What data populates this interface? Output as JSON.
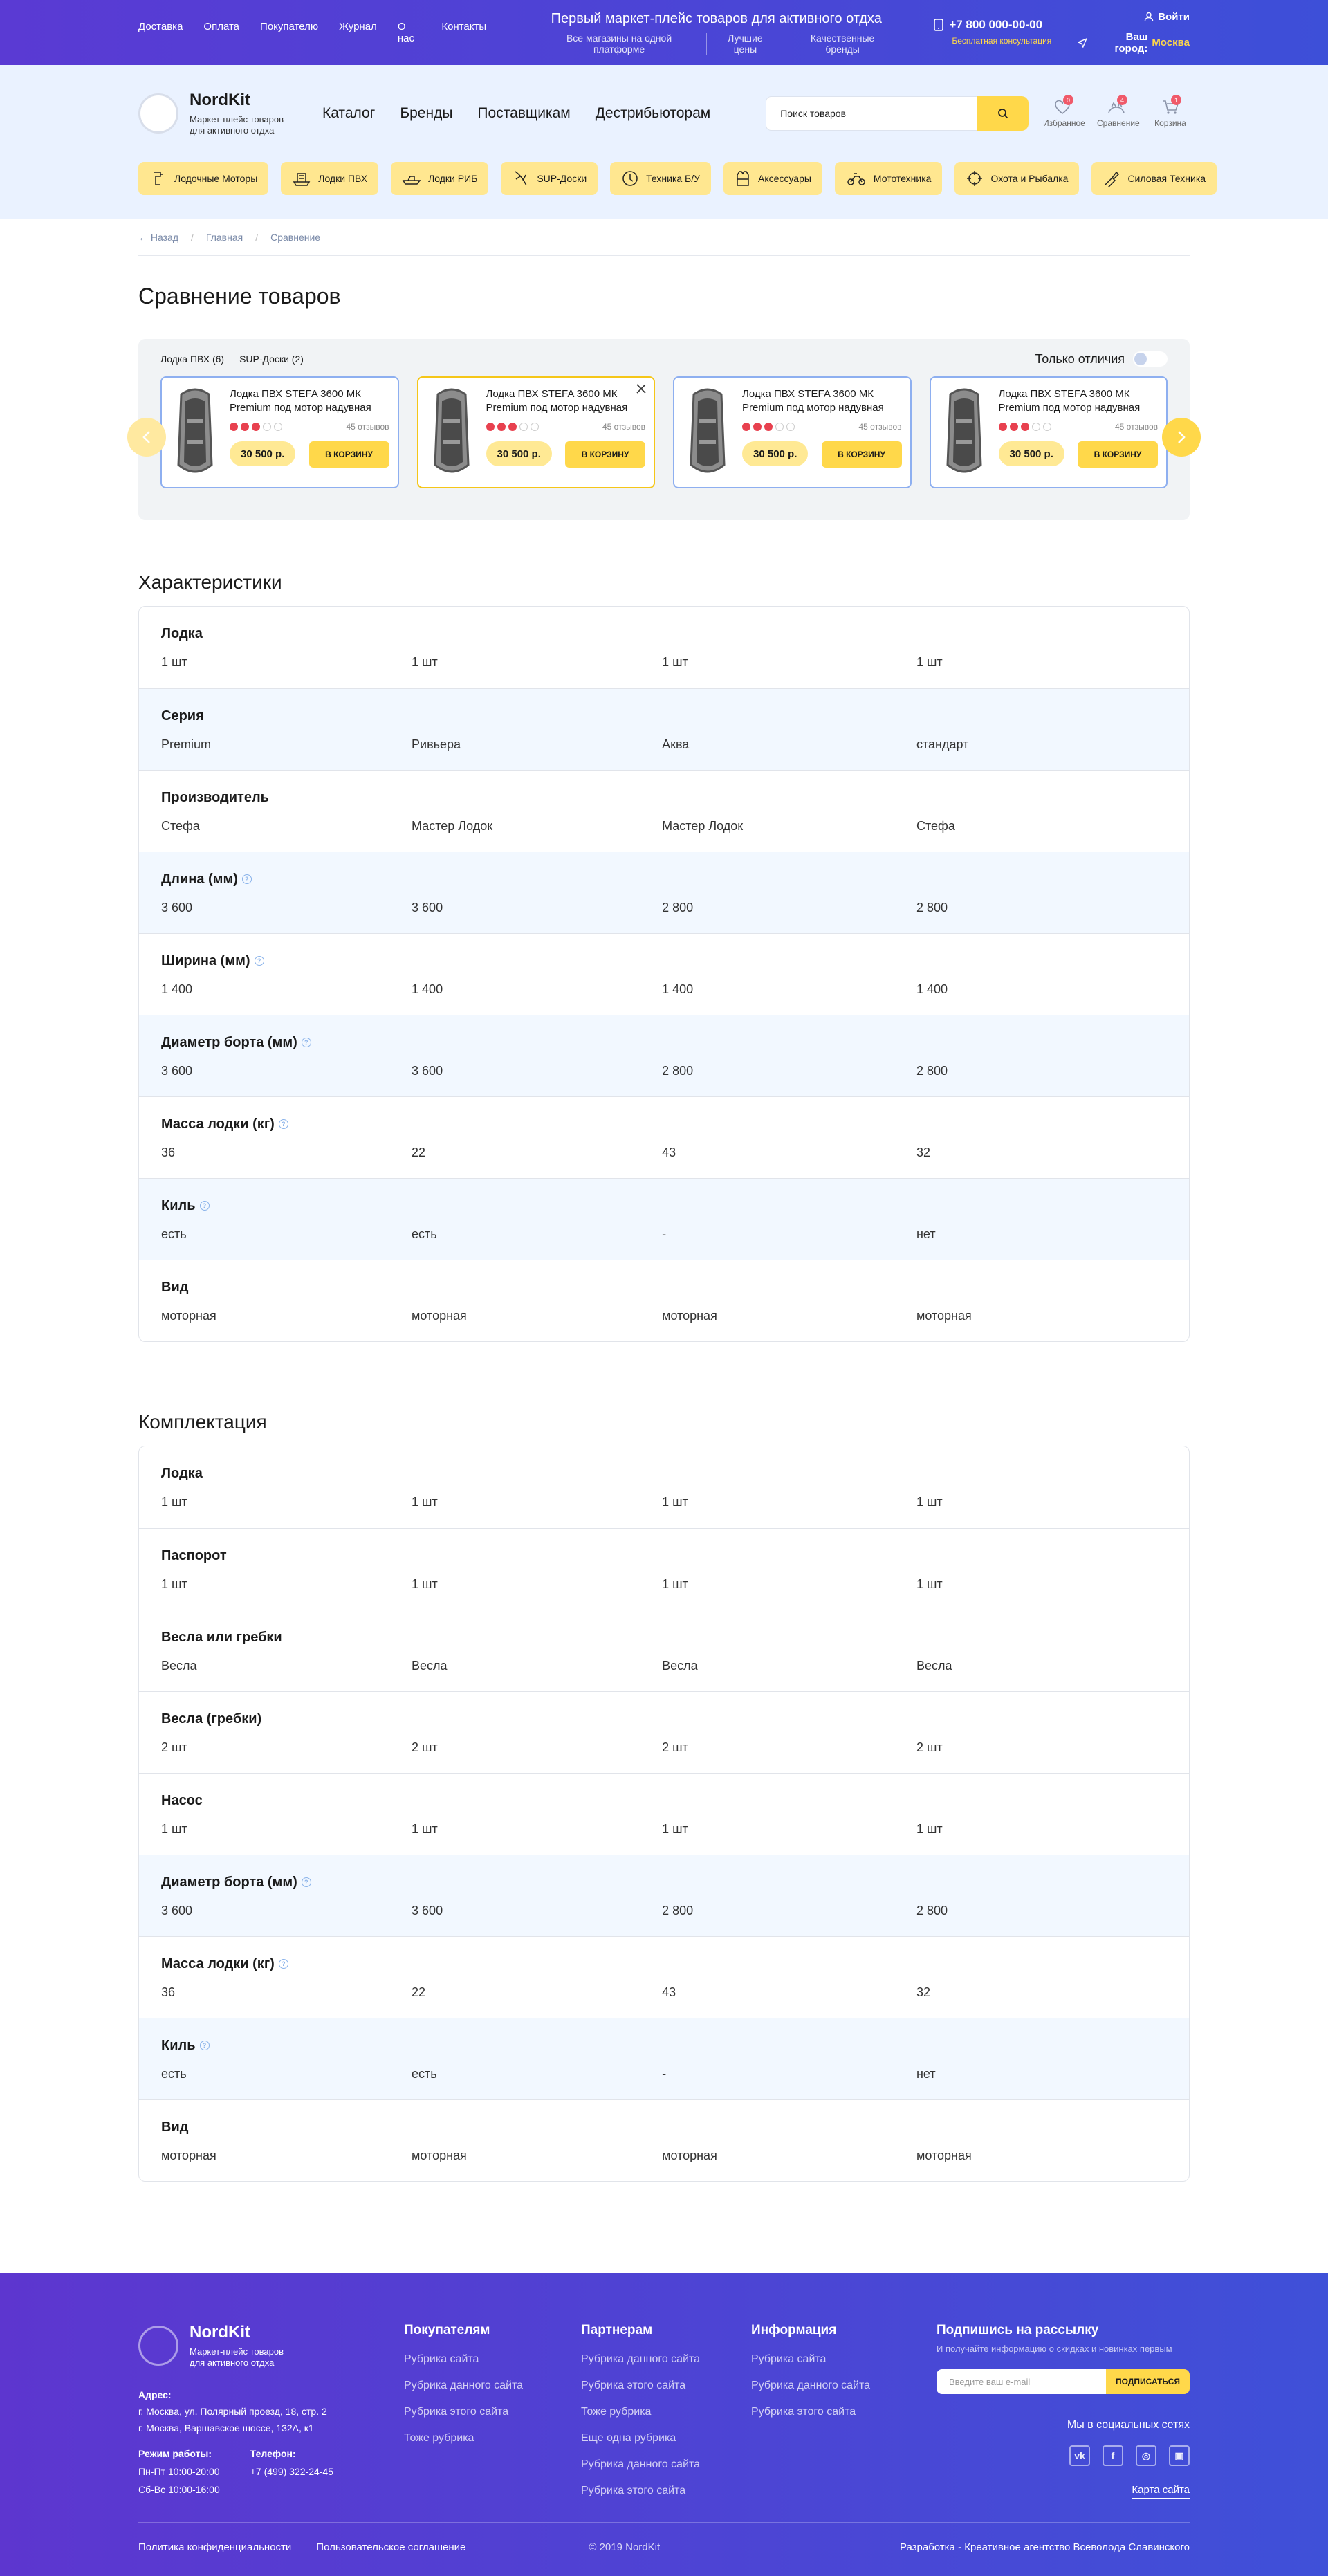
{
  "topbar": {
    "nav": [
      "Доставка",
      "Оплата",
      "Покупателю",
      "Журнал",
      "О нас",
      "Контакты"
    ],
    "headline": "Первый маркет-плейс товаров для активного отдха",
    "sub": [
      "Все магазины на одной платформе",
      "Лучшие цены",
      "Качественные бренды"
    ],
    "phone": "+7 800 000-00-00",
    "consult": "Бесплатная консультация",
    "login": "Войти",
    "city_label": "Ваш город:",
    "city": "Москва"
  },
  "header": {
    "logo_name": "NordKit",
    "logo_tag1": "Маркет-плейс товаров",
    "logo_tag2": "для активного отдха",
    "nav": [
      "Каталог",
      "Бренды",
      "Поставщикам",
      "Дестрибьюторам"
    ],
    "search_placeholder": "Поиск товаров",
    "icons": [
      {
        "label": "Избранное",
        "count": "0",
        "icon": "heart-icon"
      },
      {
        "label": "Сравнение",
        "count": "4",
        "icon": "compare-icon"
      },
      {
        "label": "Корзина",
        "count": "1",
        "icon": "cart-icon"
      }
    ],
    "categories": [
      "Лодочные Моторы",
      "Лодки ПВХ",
      "Лодки РИБ",
      "SUP-Доски",
      "Техника Б/У",
      "Аксессуары",
      "Мототехника",
      "Охота и Рыбалка",
      "Силовая Техника"
    ]
  },
  "breadcrumb": {
    "back": "Назад",
    "home": "Главная",
    "current": "Сравнение"
  },
  "page_title": "Сравнение товаров",
  "compare": {
    "tab1": "Лодка ПВХ (6)",
    "tab2": "SUP-Доски (2)",
    "only_diff": "Только отличия",
    "cards": [
      {
        "name": "Лодка ПВХ STEFA 3600 МК Premium под мотор надувная",
        "rating": 3,
        "reviews": "45 отзывов",
        "price": "30 500 р.",
        "btn": "В КОРЗИНУ"
      },
      {
        "name": "Лодка ПВХ STEFA 3600 МК Premium под мотор надувная",
        "rating": 3,
        "reviews": "45 отзывов",
        "price": "30 500 р.",
        "btn": "В КОРЗИНУ"
      },
      {
        "name": "Лодка ПВХ STEFA 3600 МК Premium под мотор надувная",
        "rating": 3,
        "reviews": "45 отзывов",
        "price": "30 500 р.",
        "btn": "В КОРЗИНУ"
      },
      {
        "name": "Лодка ПВХ STEFA 3600 МК Premium под мотор надувная",
        "rating": 3,
        "reviews": "45 отзывов",
        "price": "30 500 р.",
        "btn": "В КОРЗИНУ"
      }
    ]
  },
  "specs_title": "Характеристики",
  "specs": [
    {
      "label": "Лодка",
      "info": false,
      "vals": [
        "1 шт",
        "1 шт",
        "1 шт",
        "1 шт"
      ]
    },
    {
      "label": "Серия",
      "info": false,
      "vals": [
        "Premium",
        "Ривьера",
        "Аква",
        "стандарт"
      ]
    },
    {
      "label": "Производитель",
      "info": false,
      "vals": [
        "Стефа",
        "Мастер Лодок",
        "Мастер Лодок",
        "Стефа"
      ]
    },
    {
      "label": "Длина (мм)",
      "info": true,
      "vals": [
        "3 600",
        "3 600",
        "2 800",
        "2 800"
      ]
    },
    {
      "label": "Ширина (мм)",
      "info": true,
      "vals": [
        "1 400",
        "1 400",
        "1 400",
        "1 400"
      ]
    },
    {
      "label": "Диаметр борта (мм)",
      "info": true,
      "vals": [
        "3 600",
        "3 600",
        "2 800",
        "2 800"
      ]
    },
    {
      "label": "Масса лодки (кг)",
      "info": true,
      "vals": [
        "36",
        "22",
        "43",
        "32"
      ]
    },
    {
      "label": "Киль",
      "info": true,
      "vals": [
        "есть",
        "есть",
        "-",
        "нет"
      ]
    },
    {
      "label": "Вид",
      "info": false,
      "vals": [
        "моторная",
        "моторная",
        "моторная",
        "моторная"
      ]
    }
  ],
  "kit_title": "Комплектация",
  "kit": [
    {
      "label": "Лодка",
      "info": false,
      "vals": [
        "1 шт",
        "1 шт",
        "1 шт",
        "1 шт"
      ]
    },
    {
      "label": "Паспорот",
      "info": false,
      "vals": [
        "1 шт",
        "1 шт",
        "1 шт",
        "1 шт"
      ]
    },
    {
      "label": "Весла или гребки",
      "info": false,
      "vals": [
        "Весла",
        "Весла",
        "Весла",
        "Весла"
      ]
    },
    {
      "label": "Весла (гребки)",
      "info": false,
      "vals": [
        "2 шт",
        "2 шт",
        "2 шт",
        "2 шт"
      ]
    },
    {
      "label": "Насос",
      "info": false,
      "vals": [
        "1 шт",
        "1 шт",
        "1 шт",
        "1 шт"
      ]
    },
    {
      "label": "Диаметр борта (мм)",
      "info": true,
      "vals": [
        "3 600",
        "3 600",
        "2 800",
        "2 800"
      ]
    },
    {
      "label": "Масса лодки (кг)",
      "info": true,
      "vals": [
        "36",
        "22",
        "43",
        "32"
      ]
    },
    {
      "label": "Киль",
      "info": true,
      "vals": [
        "есть",
        "есть",
        "-",
        "нет"
      ]
    },
    {
      "label": "Вид",
      "info": false,
      "vals": [
        "моторная",
        "моторная",
        "моторная",
        "моторная"
      ]
    }
  ],
  "footer": {
    "logo_name": "NordKit",
    "logo_tag1": "Маркет-плейс товаров",
    "logo_tag2": "для активного отдха",
    "addr_label": "Адрес:",
    "addr1": "г. Москва, ул. Полярный проезд, 18, стр. 2",
    "addr2": "г. Москва, Варшавское шоссе, 132А, к1",
    "hours_label": "Режим работы:",
    "hours1": "Пн-Пт 10:00-20:00",
    "hours2": "Сб-Вс 10:00-16:00",
    "phone_label": "Телефон:",
    "phone": "+7 (499) 322-24-45",
    "cols": [
      {
        "title": "Покупателям",
        "links": [
          "Рубрика сайта",
          "Рубрика данного сайта",
          "Рубрика этого сайта",
          "Тоже рубрика"
        ]
      },
      {
        "title": "Партнерам",
        "links": [
          "Рубрика данного сайта",
          "Рубрика этого сайта",
          "Тоже рубрика",
          "Еще одна рубрика",
          "Рубрика данного сайта",
          "Рубрика этого сайта"
        ]
      },
      {
        "title": "Информация",
        "links": [
          "Рубрика сайта",
          "Рубрика данного сайта",
          "Рубрика этого сайта"
        ]
      }
    ],
    "sub_title": "Подпишись на рассылку",
    "sub_text": "И получайте информацию о скидках и новинках первым",
    "sub_placeholder": "Введите ваш e-mail",
    "sub_btn": "ПОДПИСАТЬСЯ",
    "social_title": "Мы в социальных сетях",
    "sitemap": "Карта сайта",
    "privacy": "Политика конфиденциальности",
    "terms": "Пользовательское соглашение",
    "copyright": "© 2019 NordKit",
    "dev": "Разработка - Креативное агентство Всеволода Славинского"
  }
}
